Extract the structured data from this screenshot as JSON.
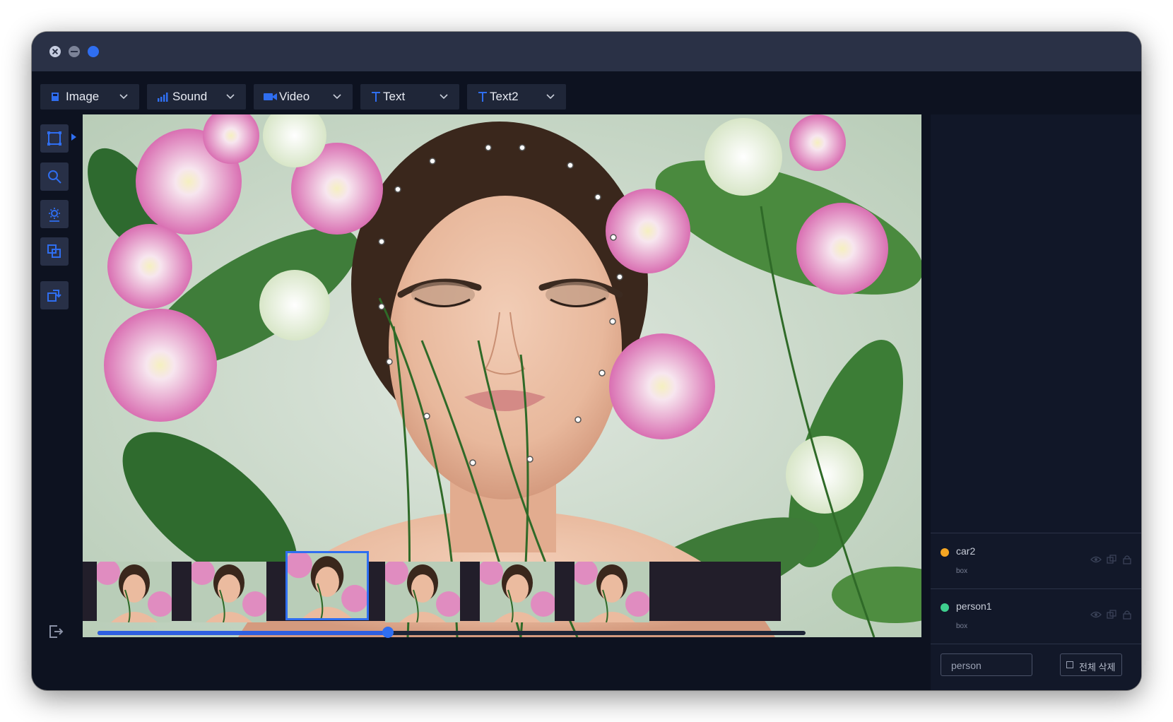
{
  "toolbar": {
    "items": [
      {
        "label": "Image",
        "icon": "image-icon"
      },
      {
        "label": "Sound",
        "icon": "sound-bars-icon"
      },
      {
        "label": "Video",
        "icon": "video-camera-icon"
      },
      {
        "label": "Text",
        "icon": "text-t-icon"
      },
      {
        "label": "Text2",
        "icon": "text-t-icon"
      }
    ]
  },
  "tools": [
    "bounding-box-icon",
    "search-icon",
    "brightness-icon",
    "copy-layers-icon",
    "rotate-icon"
  ],
  "video": {
    "selected_frame": 3,
    "frame_count": 6,
    "progress": 0.41
  },
  "objects": [
    {
      "name": "car2",
      "type": "box",
      "color": "#f5a623"
    },
    {
      "name": "person1",
      "type": "box",
      "color": "#3ecf8e"
    }
  ],
  "search": {
    "value": "person"
  },
  "delete_all": {
    "label": "전체 삭제"
  },
  "colors": {
    "accent": "#2f6ef0",
    "panel": "#1f2638",
    "background": "#0d1220"
  }
}
